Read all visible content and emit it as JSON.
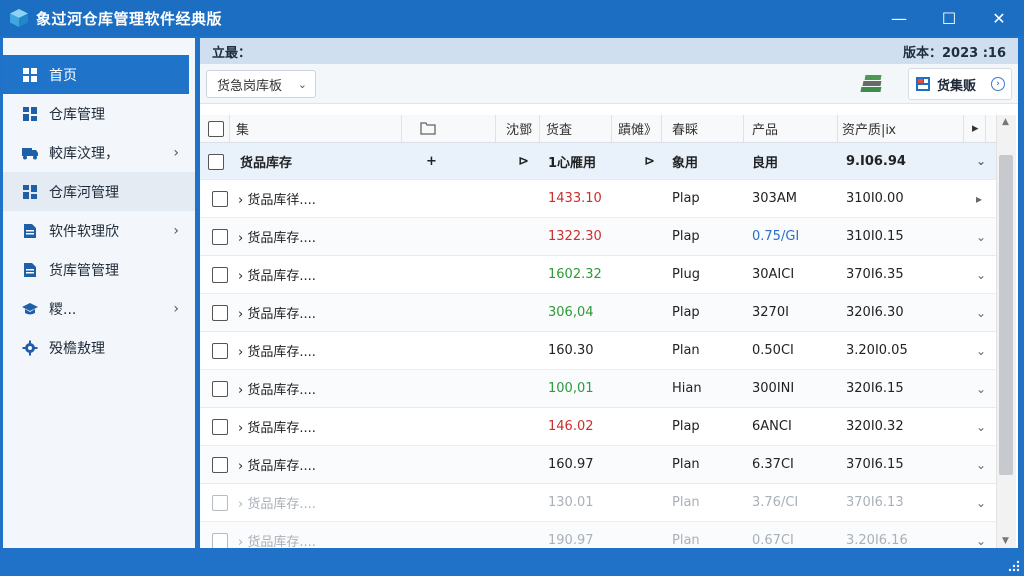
{
  "window": {
    "title": "象过河仓库管理软件经典版",
    "controls": {
      "minimize": "—",
      "maximize": "☐",
      "close": "✕"
    }
  },
  "sidebar": {
    "items": [
      {
        "label": "首页",
        "icon": "dashboard-icon",
        "active": true,
        "chevron": false
      },
      {
        "label": "仓库管理",
        "icon": "warehouse-grid-icon",
        "active": false,
        "chevron": false
      },
      {
        "label": "較库汶理，",
        "icon": "truck-icon",
        "active": false,
        "chevron": true
      },
      {
        "label": "仓库河管理",
        "icon": "warehouse-grid-icon",
        "active": false,
        "chevron": false,
        "highlighted": true
      },
      {
        "label": "软件软理欣",
        "icon": "document-icon",
        "active": false,
        "chevron": true
      },
      {
        "label": "货库管管理",
        "icon": "document-icon",
        "active": false,
        "chevron": false
      },
      {
        "label": "糭...",
        "icon": "graduation-cap-icon",
        "active": false,
        "chevron": true
      },
      {
        "label": "殁檐敖理",
        "icon": "gear-icon",
        "active": false,
        "chevron": false
      }
    ]
  },
  "infobar": {
    "left": "立最：",
    "right": "版本：2023 :16"
  },
  "toolbar": {
    "dropdown_label": "货急岗库板",
    "store_button_label": "货集贩"
  },
  "table": {
    "headers": [
      "",
      "集",
      "",
      "沈鄧",
      "货査",
      "蹟傩》",
      "春睬",
      "产品",
      "资产质|ⅸ",
      "▸"
    ],
    "group_row": {
      "name": "货品库存",
      "col3": "+",
      "col4": "⊳",
      "qty": "1心雁用",
      "col6": "⊳",
      "unit": "象用",
      "product": "良用",
      "asset": "9.Ⅰ06.94"
    },
    "rows": [
      {
        "name": "› 货品库徉....",
        "qty": "1433.10",
        "qty_color": "red",
        "unit": "Plap",
        "product": "303AM",
        "product_color": "",
        "asset": "310Ⅰ0.00",
        "action": "▸",
        "faded": false
      },
      {
        "name": "› 货品库存....",
        "qty": "1322.30",
        "qty_color": "red",
        "unit": "Plap",
        "product": "0.75/GI",
        "product_color": "blue",
        "asset": "310Ⅰ0.15",
        "action": "⌄",
        "faded": false
      },
      {
        "name": "› 货品库存....",
        "qty": "1602.32",
        "qty_color": "green",
        "unit": "Plug",
        "product": "30AICI",
        "product_color": "",
        "asset": "370Ⅰ6.35",
        "action": "⌄",
        "faded": false
      },
      {
        "name": "› 货品库存....",
        "qty": "306,04",
        "qty_color": "green",
        "unit": "Plap",
        "product": "3270I",
        "product_color": "",
        "asset": "320Ⅰ6.30",
        "action": "⌄",
        "faded": false
      },
      {
        "name": "› 货品库存....",
        "qty": "160.30",
        "qty_color": "",
        "unit": "Plan",
        "product": "0.50CI",
        "product_color": "",
        "asset": "3.20Ⅰ0.05",
        "action": "⌄",
        "faded": false
      },
      {
        "name": "› 货品库存....",
        "qty": "100,01",
        "qty_color": "green",
        "unit": "Hian",
        "product": "300INI",
        "product_color": "",
        "asset": "320Ⅰ6.15",
        "action": "⌄",
        "faded": false
      },
      {
        "name": "› 货品库存....",
        "qty": "146.02",
        "qty_color": "red",
        "unit": "Plap",
        "product": "6ANCI",
        "product_color": "",
        "asset": "320Ⅰ0.32",
        "action": "⌄",
        "faded": false
      },
      {
        "name": "› 货品库存....",
        "qty": "160.97",
        "qty_color": "",
        "unit": "Plan",
        "product": "6.37CI",
        "product_color": "",
        "asset": "370Ⅰ6.15",
        "action": "⌄",
        "faded": false
      },
      {
        "name": "› 货品库存....",
        "qty": "130.01",
        "qty_color": "",
        "unit": "Plan",
        "product": "3.76/CI",
        "product_color": "",
        "asset": "370Ⅰ6.13",
        "action": "⌄",
        "faded": true
      },
      {
        "name": "› 货品库存....",
        "qty": "190.97",
        "qty_color": "",
        "unit": "Plan",
        "product": "0.67CI",
        "product_color": "",
        "asset": "3.20Ⅰ6.16",
        "action": "⌄",
        "faded": true
      }
    ]
  },
  "colors": {
    "titlebar": "#1b6ec2",
    "active_nav": "#1f73c9",
    "red_value": "#c9302c",
    "green_value": "#2e9a3a"
  }
}
